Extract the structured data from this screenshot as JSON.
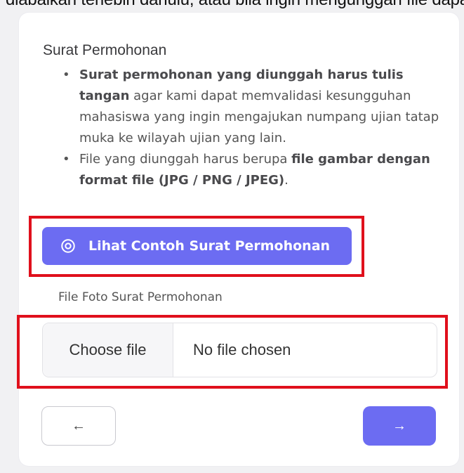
{
  "top_caption": "diabaikan terlebih dahulu, atau bila ingin mengunggah file dapat menekan tombol Choose file, yang ditunjukkan sesuai",
  "section": {
    "title": "Surat Permohonan",
    "notes": [
      {
        "bold": "Surat permohonan yang diunggah harus tulis tangan",
        "rest": " agar kami dapat memvalidasi kesungguhan mahasiswa yang ingin mengajukan numpang ujian tatap muka ke wilayah ujian yang lain."
      },
      {
        "pre": "File yang diunggah harus berupa ",
        "bold": "file gambar dengan format file (JPG / PNG / JPEG)",
        "post": "."
      }
    ]
  },
  "example_button": {
    "label": "Lihat Contoh Surat Permohonan",
    "icon": "eye-icon",
    "color": "#6c6cf2"
  },
  "upload": {
    "label": "File Foto Surat Permohonan",
    "choose_label": "Choose file",
    "status": "No file chosen"
  },
  "nav": {
    "back_icon": "←",
    "next_icon": "→"
  },
  "highlight_color": "#e0101c"
}
